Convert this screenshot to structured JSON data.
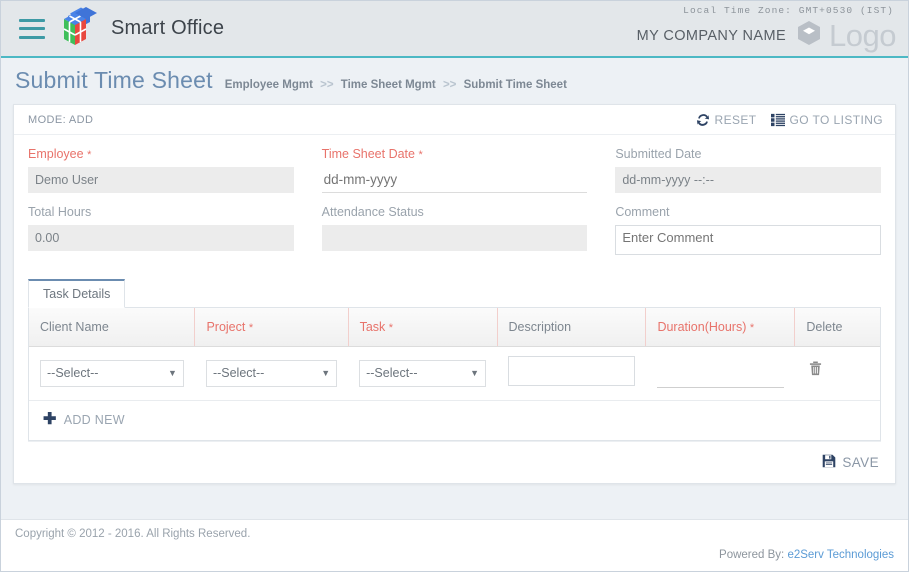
{
  "header": {
    "menu_icon": "hamburger-icon",
    "logo_icon": "cube-logo-icon",
    "brand": "Smart Office",
    "timezone": "Local Time Zone: GMT+0530 (IST)",
    "company_name": "MY COMPANY NAME",
    "logo_mark_icon": "hexagon-cube-icon",
    "logo_word": "Logo"
  },
  "page": {
    "title": "Submit Time Sheet",
    "breadcrumb": [
      "Employee Mgmt",
      "Time Sheet Mgmt",
      "Submit Time Sheet"
    ],
    "breadcrumb_separator": ">>"
  },
  "card": {
    "mode": "MODE: ADD",
    "reset_label": "RESET",
    "reset_icon": "refresh-icon",
    "listing_label": "GO TO LISTING",
    "listing_icon": "list-icon"
  },
  "form": {
    "employee": {
      "label": "Employee",
      "required": true,
      "value": "Demo User"
    },
    "timesheet_date": {
      "label": "Time Sheet Date",
      "required": true,
      "value": "",
      "placeholder": "dd-mm-yyyy"
    },
    "submitted_date": {
      "label": "Submitted Date",
      "required": false,
      "value": "dd-mm-yyyy --:--"
    },
    "total_hours": {
      "label": "Total Hours",
      "required": false,
      "value": "0.00"
    },
    "attendance_status": {
      "label": "Attendance Status",
      "required": false,
      "value": ""
    },
    "comment": {
      "label": "Comment",
      "required": false,
      "value": "",
      "placeholder": "Enter Comment"
    }
  },
  "tabs": [
    {
      "label": "Task Details",
      "active": true
    }
  ],
  "task_table": {
    "columns": [
      {
        "label": "Client Name",
        "required": false
      },
      {
        "label": "Project",
        "required": true
      },
      {
        "label": "Task",
        "required": true
      },
      {
        "label": "Description",
        "required": false
      },
      {
        "label": "Duration(Hours)",
        "required": true
      },
      {
        "label": "Delete",
        "required": false
      }
    ],
    "required_marker": "*",
    "rows": [
      {
        "client_name": "--Select--",
        "project": "--Select--",
        "task": "--Select--",
        "description": "",
        "duration": "",
        "delete_icon": "trash-icon"
      }
    ],
    "add_new_label": "ADD NEW",
    "add_new_icon": "plus-icon"
  },
  "actions": {
    "save_label": "SAVE",
    "save_icon": "floppy-save-icon"
  },
  "footer": {
    "copyright": "Copyright © 2012 - 2016. All Rights Reserved.",
    "powered_by_prefix": "Powered By:",
    "powered_by_link": "e2Serv Technologies"
  },
  "colors": {
    "accent_teal": "#4cb8c4",
    "title_blue": "#6b8cb0",
    "required_red": "#e8736b",
    "link_blue": "#5b9bd5",
    "page_bg": "#edf1f5"
  }
}
